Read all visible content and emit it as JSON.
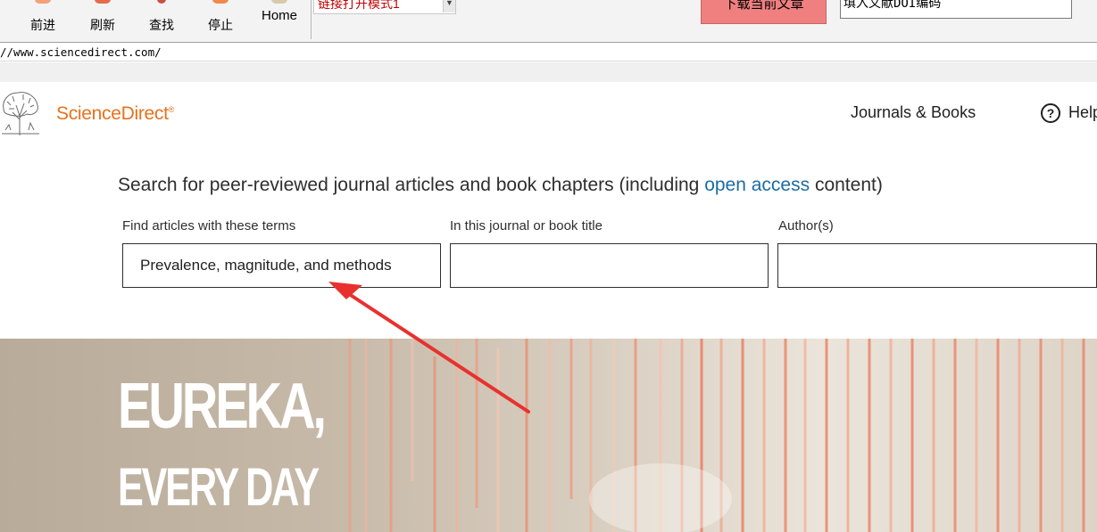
{
  "toolbar": {
    "buttons": [
      {
        "label": "前进",
        "icon": "forward-icon"
      },
      {
        "label": "刷新",
        "icon": "refresh-icon"
      },
      {
        "label": "查找",
        "icon": "find-icon"
      },
      {
        "label": "停止",
        "icon": "stop-icon"
      },
      {
        "label": "Home",
        "icon": "home-icon"
      }
    ],
    "mode_select_value": "链接打开模式1",
    "download_button": "下载当前文章",
    "doi_input_value": "填入文献DOI编码"
  },
  "address": {
    "url": "//www.sciencedirect.com/"
  },
  "site": {
    "brand": "ScienceDirect",
    "brand_mark": "®",
    "nav": {
      "journals_books": "Journals & Books",
      "help": "Help"
    }
  },
  "search": {
    "heading_before": "Search for peer-reviewed journal articles and book chapters (including ",
    "heading_link": "open access",
    "heading_after": " content)",
    "fields": [
      {
        "label": "Find articles with these terms",
        "value": "Prevalence, magnitude, and methods"
      },
      {
        "label": "In this journal or book title",
        "value": ""
      },
      {
        "label": "Author(s)",
        "value": ""
      }
    ]
  },
  "banner": {
    "line1": "EUREKA,",
    "line2": "EVERY DAY"
  },
  "colors": {
    "brand_orange": "#e9711c",
    "link_blue": "#1a6da3",
    "download_button_bg": "#f08080",
    "annotation_red": "#e8312f"
  }
}
